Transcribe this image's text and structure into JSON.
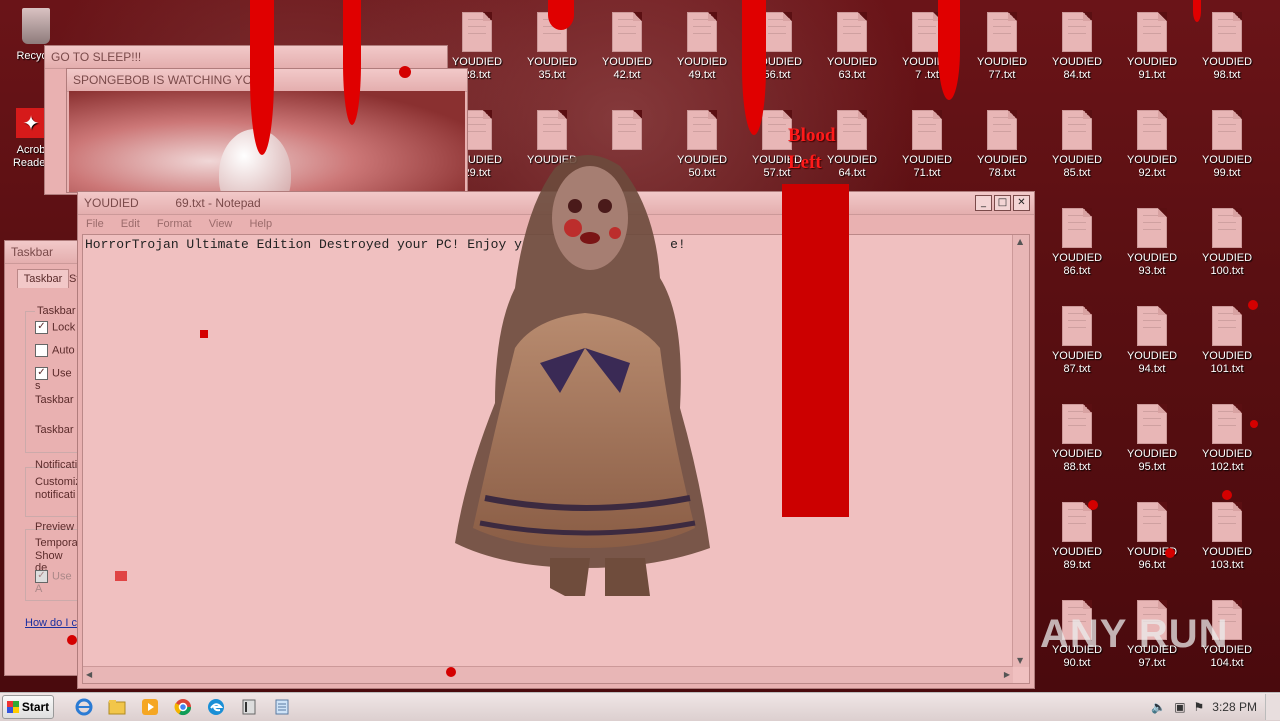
{
  "desktop": {
    "recycle_label": "Recycle",
    "acrobat_label_1": "Acrob",
    "acrobat_label_2": "Reader",
    "file_prefix": "YOUDIED",
    "files": [
      "28.txt",
      "35.txt",
      "42.txt",
      "49.txt",
      "56.txt",
      "63.txt",
      "7 .txt",
      "77.txt",
      "84.txt",
      "91.txt",
      "98.txt",
      "29.txt",
      "",
      "",
      "50.txt",
      "57.txt",
      "64.txt",
      "71.txt",
      "78.txt",
      "85.txt",
      "92.txt",
      "99.txt",
      "86.txt",
      "93.txt",
      "100.txt",
      "87.txt",
      "94.txt",
      "101.txt",
      "88.txt",
      "95.txt",
      "102.txt",
      "89.txt",
      "96.txt",
      "103.txt",
      "90.txt",
      "97.txt",
      "104.txt"
    ]
  },
  "sponge_windows": {
    "back_title": "GO TO SLEEP!!!",
    "front_title": "SPONGEBOB IS WATCHING YOU!"
  },
  "notepad": {
    "title": "YOUDIED           69.txt - Notepad",
    "menu": [
      "File",
      "Edit",
      "Format",
      "View",
      "Help"
    ],
    "text": "HorrorTrojan Ultimate Edition Destroyed your PC! Enjoy y                   e!"
  },
  "taskbar_props": {
    "title": "Taskbar",
    "tab": "Taskbar",
    "tab2": "St",
    "group_taskbar": "Taskbar",
    "lock": "Lock",
    "auto": "Auto",
    "use_small": "Use s",
    "taskbar_loc": "Taskbar",
    "taskbar_btn": "Taskbar",
    "notif_group": "Notificati",
    "customize_1": "Customiz",
    "customize_2": "notificati",
    "preview_group": "Preview",
    "temp_1": "Tempora",
    "temp_2": "Show de",
    "use_aero": "Use A",
    "howdo": "How do I c"
  },
  "overlay": {
    "blood_left_1": "Blood",
    "blood_left_2": "Left",
    "watermark": "ANY RUN"
  },
  "taskbar": {
    "start_label": "Start",
    "clock": "3:28 PM"
  },
  "colors": {
    "blood": "#e00000",
    "notepad_bg": "#f0c0c0"
  }
}
